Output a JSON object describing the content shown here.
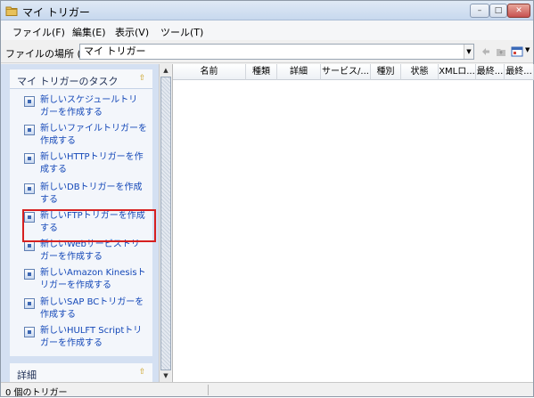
{
  "window": {
    "title": "マイ トリガー",
    "controls": {
      "minimize": "–",
      "maximize": "□",
      "close": "✕"
    }
  },
  "menu": [
    "ファイル(F)",
    "編集(E)",
    "表示(V)",
    "ツール(T)"
  ],
  "address": {
    "label": "ファイルの場所 (D)",
    "value": "マイ トリガー"
  },
  "tasks": {
    "header": "マイ トリガーのタスク",
    "items": [
      {
        "line1": "新しいスケジュールトリ",
        "line2": "ガーを作成する"
      },
      {
        "line1": "新しいファイルトリガーを",
        "line2": "作成する"
      },
      {
        "line1": "新しいHTTPトリガーを作",
        "line2": "成する"
      },
      {
        "line1": "新しいDBトリガーを作成",
        "line2": "する"
      },
      {
        "line1": "新しいFTPトリガーを作成",
        "line2": "する"
      },
      {
        "line1": "新しいWebサービストリ",
        "line2": "ガーを作成する"
      },
      {
        "line1": "新しいAmazon Kinesisト",
        "line2": "リガーを作成する"
      },
      {
        "line1": "新しいSAP BCトリガーを",
        "line2": "作成する"
      },
      {
        "line1": "新しいHULFT Scriptトリ",
        "line2": "ガーを作成する"
      }
    ],
    "detail_header": "詳細"
  },
  "list": {
    "columns": [
      "名前",
      "種類",
      "詳細",
      "サービス/...",
      "種別",
      "状態",
      "XMLロ...",
      "最終...",
      "最終..."
    ]
  },
  "status": {
    "text": "0 個のトリガー"
  },
  "colors": {
    "link": "#1448b8",
    "highlight_border": "#d62020",
    "pane_bg": "#d4e0f2"
  }
}
